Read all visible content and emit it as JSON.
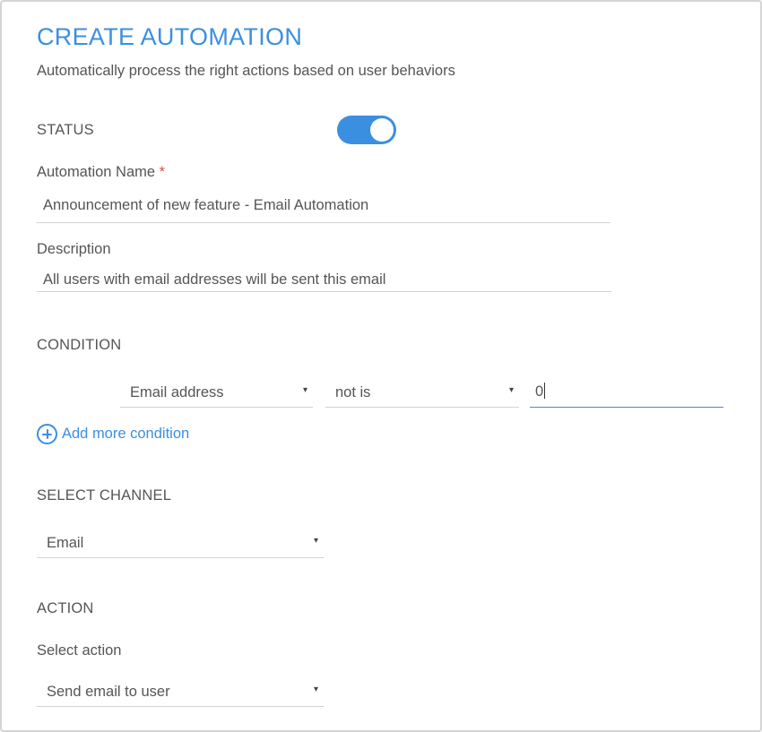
{
  "header": {
    "title": "CREATE AUTOMATION",
    "subtitle": "Automatically process the right actions based on user behaviors"
  },
  "status": {
    "label": "STATUS",
    "enabled": true,
    "accent_color": "#3b8fe0"
  },
  "automation_name": {
    "label": "Automation Name",
    "required_mark": "*",
    "value": "Announcement of new feature - Email Automation"
  },
  "description": {
    "label": "Description",
    "value": "All users with email addresses will be sent this email"
  },
  "condition": {
    "label": "CONDITION",
    "field": "Email address",
    "operator": "not is",
    "value": "0",
    "add_label": "Add more condition"
  },
  "channel": {
    "label": "SELECT CHANNEL",
    "selected": "Email"
  },
  "action": {
    "label": "ACTION",
    "select_label": "Select action",
    "selected": "Send email to user"
  },
  "icons": {
    "dropdown_arrow": "▾",
    "add_icon": "plus-circle-icon"
  }
}
